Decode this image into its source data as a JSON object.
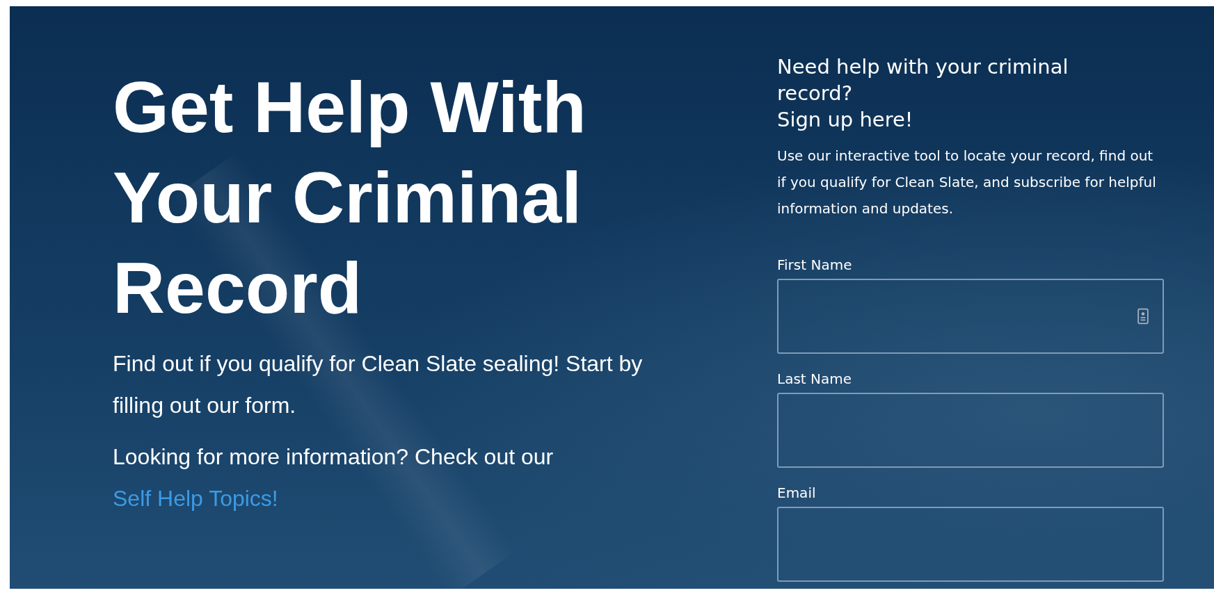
{
  "hero": {
    "title": "Get Help With Your Criminal Record",
    "intro": "Find out if you qualify for Clean Slate sealing! Start by filling out our form.",
    "more_text": "Looking for more information? Check out our",
    "more_link": "Self Help Topics!"
  },
  "signup": {
    "heading_lines": [
      "Need help with your criminal record?",
      "Sign up here!"
    ],
    "description": "Use our interactive tool to locate your record, find out if you qualify for Clean Slate, and subscribe for helpful information and updates.",
    "fields": [
      {
        "label": "First Name",
        "autofill_icon": true
      },
      {
        "label": "Last Name",
        "autofill_icon": false
      },
      {
        "label": "Email",
        "autofill_icon": false
      }
    ]
  }
}
